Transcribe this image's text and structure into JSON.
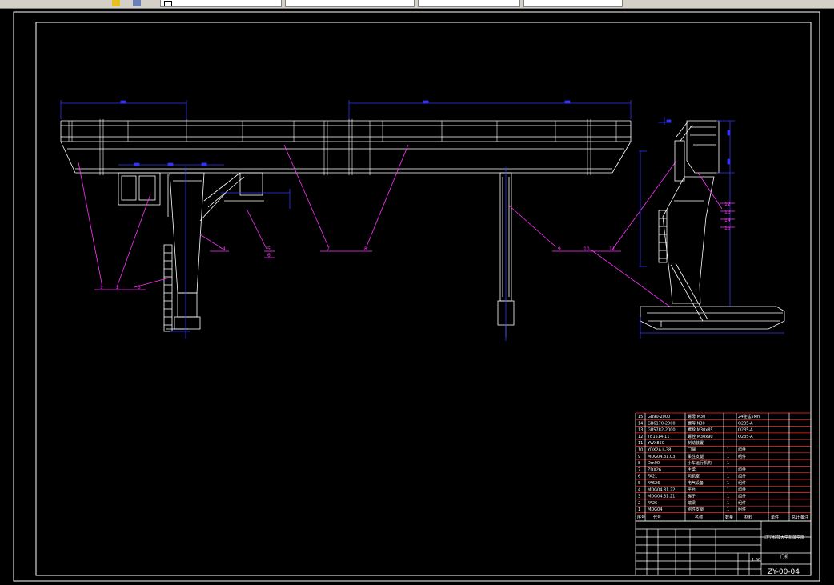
{
  "colors": {
    "background": "#000000",
    "outline": "#ffffff",
    "dimension": "#3333ff",
    "callout": "#ff33ff",
    "centerline": "#2a2aff",
    "table_border": "#ff2a2a"
  },
  "icons": [
    "layer-icon",
    "cube-icon",
    "layer-properties-icon"
  ],
  "balloons": {
    "front": [
      "1",
      "2",
      "3",
      "4",
      "5",
      "6",
      "7",
      "8",
      "9",
      "10",
      "11"
    ],
    "side": [
      "12",
      "13",
      "14",
      "15"
    ]
  },
  "parts_table": {
    "rows": [
      {
        "no": "15",
        "code": "GB90-2000",
        "name": "螺母 M30",
        "qty": "",
        "material": "24硅锰5Mn"
      },
      {
        "no": "14",
        "code": "GB6170-2000",
        "name": "螺母 N30",
        "qty": "",
        "material": "Q235-A"
      },
      {
        "no": "13",
        "code": "GB5782-2000",
        "name": "螺栓 M30x85",
        "qty": "",
        "material": "Q235-A"
      },
      {
        "no": "12",
        "code": "TB1514-11",
        "name": "螺栓 M30x90",
        "qty": "",
        "material": "Q235-A"
      },
      {
        "no": "11",
        "code": "YWX850",
        "name": "制动装置",
        "qty": "",
        "material": ""
      },
      {
        "no": "10",
        "code": "YDX2A.L-38",
        "name": "门腿",
        "qty": "1",
        "material": "组件"
      },
      {
        "no": "9",
        "code": "MDG04.31.03",
        "name": "柔性支腿",
        "qty": "1",
        "material": "组件"
      },
      {
        "no": "8",
        "code": "Dm90",
        "name": "小车运行机构",
        "qty": "1",
        "material": ""
      },
      {
        "no": "7",
        "code": "ZDX26",
        "name": "主梁",
        "qty": "1",
        "material": "组件"
      },
      {
        "no": "6",
        "code": "FA21",
        "name": "司机室",
        "qty": "1",
        "material": "组件"
      },
      {
        "no": "5",
        "code": "FA626",
        "name": "电气设备",
        "qty": "1",
        "material": "组件"
      },
      {
        "no": "4",
        "code": "MDG04.31.22",
        "name": "平台",
        "qty": "1",
        "material": "组件"
      },
      {
        "no": "3",
        "code": "MDG04.31.21",
        "name": "梯子",
        "qty": "1",
        "material": "组件"
      },
      {
        "no": "2",
        "code": "FA26",
        "name": "端梁",
        "qty": "1",
        "material": "组件"
      },
      {
        "no": "1",
        "code": "MDG04",
        "name": "刚性支腿",
        "qty": "1",
        "material": "组件"
      }
    ],
    "headers": [
      "序号",
      "代号",
      "名称",
      "数量",
      "材料",
      "单件",
      "总计",
      "备注"
    ],
    "school": "辽宁科技大学机械学院",
    "drawing_title": "门机",
    "scale": "1:50",
    "drawing_no": "ZY-00-04"
  }
}
